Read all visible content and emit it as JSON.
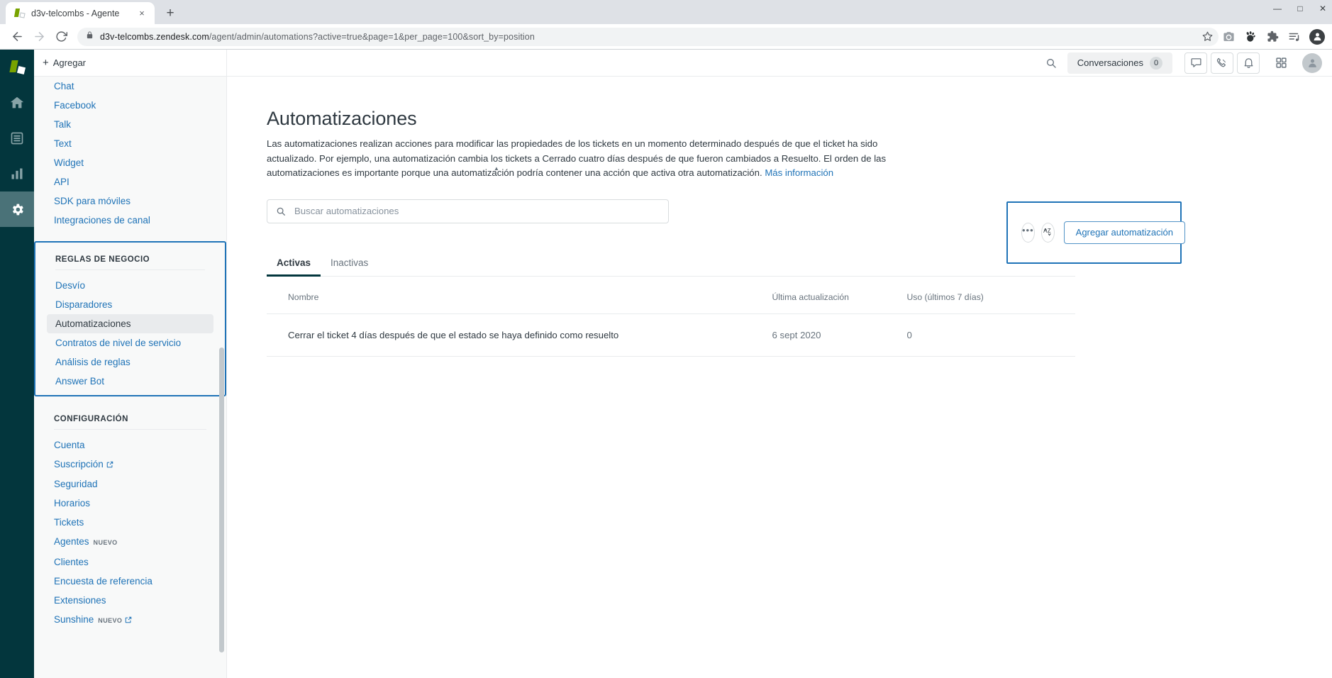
{
  "browser": {
    "tab": {
      "title": "d3v-telcombs - Agente",
      "favicon": "zendesk-logo-icon",
      "close": "×"
    },
    "new_tab_label": "+",
    "window_controls": {
      "minimize": "—",
      "maximize": "□",
      "close": "✕"
    },
    "nav": {
      "back": "back-icon",
      "forward": "forward-icon",
      "reload": "reload-icon"
    },
    "address": {
      "lock": "lock-icon",
      "host": "d3v-telcombs.zendesk.com",
      "path": "/agent/admin/automations?active=true&page=1&per_page=100&sort_by=position"
    },
    "toolbar_icons": [
      "star-icon",
      "camera-icon",
      "gnome-icon",
      "puzzle-icon",
      "media-list-icon",
      "profile-avatar"
    ]
  },
  "rail": {
    "logo": "zendesk-logo",
    "items": [
      {
        "name": "home-icon",
        "active": false
      },
      {
        "name": "views-icon",
        "active": false
      },
      {
        "name": "reporting-icon",
        "active": false
      },
      {
        "name": "admin-gear-icon",
        "active": true
      }
    ]
  },
  "sidebar": {
    "add_label": "Agregar",
    "channels": [
      {
        "label": "Chat"
      },
      {
        "label": "Facebook"
      },
      {
        "label": "Talk"
      },
      {
        "label": "Text"
      },
      {
        "label": "Widget"
      },
      {
        "label": "API"
      },
      {
        "label": "SDK para móviles"
      },
      {
        "label": "Integraciones de canal"
      }
    ],
    "business_rules": {
      "title": "REGLAS DE NEGOCIO",
      "items": [
        {
          "label": "Desvío",
          "current": false
        },
        {
          "label": "Disparadores",
          "current": false
        },
        {
          "label": "Automatizaciones",
          "current": true
        },
        {
          "label": "Contratos de nivel de servicio",
          "current": false
        },
        {
          "label": "Análisis de reglas",
          "current": false
        },
        {
          "label": "Answer Bot",
          "current": false
        }
      ]
    },
    "settings": {
      "title": "CONFIGURACIÓN",
      "items": [
        {
          "label": "Cuenta",
          "external": false,
          "badge": ""
        },
        {
          "label": "Suscripción",
          "external": true,
          "badge": ""
        },
        {
          "label": "Seguridad",
          "external": false,
          "badge": ""
        },
        {
          "label": "Horarios",
          "external": false,
          "badge": ""
        },
        {
          "label": "Tickets",
          "external": false,
          "badge": ""
        },
        {
          "label": "Agentes",
          "external": false,
          "badge": "NUEVO"
        },
        {
          "label": "Clientes",
          "external": false,
          "badge": ""
        },
        {
          "label": "Encuesta de referencia",
          "external": false,
          "badge": ""
        },
        {
          "label": "Extensiones",
          "external": false,
          "badge": ""
        },
        {
          "label": "Sunshine",
          "external": true,
          "badge": "NUEVO"
        }
      ]
    }
  },
  "header": {
    "search_icon": "search-icon",
    "conversations_label": "Conversaciones",
    "conversations_count": "0",
    "chat_icon": "chat-bubble-icon",
    "talk_icon": "phone-icon",
    "bell_icon": "notification-bell-icon",
    "apps_icon": "apps-grid-icon",
    "avatar": "user-avatar"
  },
  "main": {
    "title": "Automatizaciones",
    "description": "Las automatizaciones realizan acciones para modificar las propiedades de los tickets en un momento determinado después de que el ticket ha sido actualizado. Por ejemplo, una automatización cambia los tickets a Cerrado cuatro días después de que fueron cambiados a Resuelto. El orden de las automatizaciones es importante porque una automatización podría contener una acción que activa otra automatización. ",
    "learn_more": "Más información",
    "search_placeholder": "Buscar automatizaciones",
    "search_value": "",
    "actions": {
      "more_label": "•••",
      "sort_label": "AZ",
      "add_label": "Agregar automatización"
    },
    "tabs": [
      {
        "label": "Activas",
        "active": true
      },
      {
        "label": "Inactivas",
        "active": false
      }
    ],
    "table": {
      "columns": [
        "Nombre",
        "Última actualización",
        "Uso (últimos 7 días)"
      ],
      "rows": [
        {
          "name": "Cerrar el ticket 4 días después de que el estado se haya definido como resuelto",
          "updated": "6 sept 2020",
          "usage": "0"
        }
      ]
    }
  },
  "colors": {
    "rail_bg": "#03363d",
    "rail_active": "#4a7278",
    "link": "#1f73b7",
    "text": "#2f3941",
    "muted": "#68737d",
    "highlight_border": "#1f73b7",
    "zendesk_green": "#78a300"
  }
}
